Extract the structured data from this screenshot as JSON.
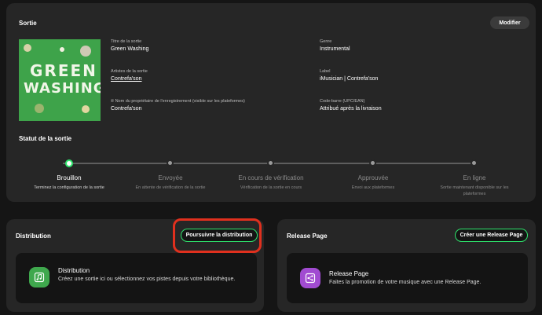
{
  "release": {
    "title": "Sortie",
    "edit_label": "Modifier",
    "fields": {
      "title_label": "Titre de la sortie",
      "title_value": "Green Washing",
      "artists_label": "Artistes de la sortie",
      "artists_value": "Contrefa'son",
      "owner_label": "℗ Nom du propriétaire de l'enregistrement (visible sur les plateformes)",
      "owner_value": "Contrefa'son",
      "genre_label": "Genre",
      "genre_value": "Instrumental",
      "label_label": "Label",
      "label_value": "iMusician | Contrefa'son",
      "barcode_label": "Code-barre (UPC/EAN)",
      "barcode_value": "Attribué après la livraison"
    },
    "cover": {
      "line1": "GREEN",
      "line2": "WASHING"
    }
  },
  "status": {
    "title": "Statut de la sortie",
    "current_step": 0,
    "steps": [
      {
        "name": "Brouillon",
        "desc": "Terminez la configuration de la sortie"
      },
      {
        "name": "Envoyée",
        "desc": "En attente de vérification de la sortie"
      },
      {
        "name": "En cours de vérification",
        "desc": "Vérification de la sortie en cours"
      },
      {
        "name": "Approuvée",
        "desc": "Envoi aux plateformes"
      },
      {
        "name": "En ligne",
        "desc": "Sortie maintenant disponible sur les plateformes"
      }
    ]
  },
  "distribution": {
    "title": "Distribution",
    "button_label": "Poursuivre la distribution",
    "item_title": "Distribution",
    "item_desc": "Créez une sortie ici ou sélectionnez vos pistes depuis votre bibliothèque."
  },
  "release_page": {
    "title": "Release Page",
    "button_label": "Créer une Release Page",
    "item_title": "Release Page",
    "item_desc": "Faites la promotion de votre musique avec une Release Page."
  },
  "colors": {
    "accent": "#2fe66d",
    "highlight": "#e0301e",
    "distribution_icon": "#3fa84d",
    "release_page_icon": "#a14bd1"
  },
  "icons": {
    "distribution": "music-note-icon",
    "release_page": "share-icon"
  }
}
